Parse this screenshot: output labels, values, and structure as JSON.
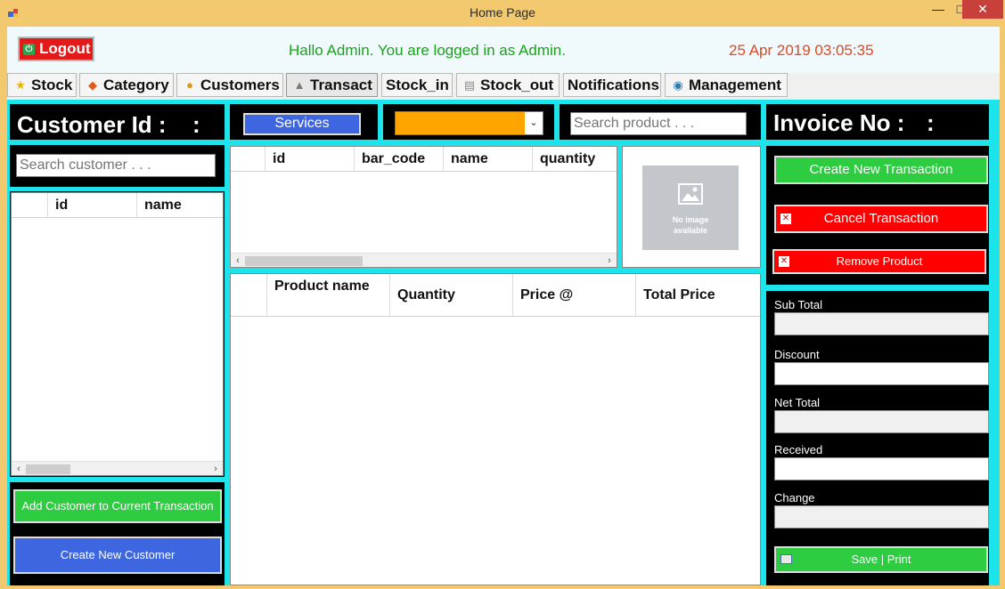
{
  "window": {
    "title": "Home Page",
    "min_glyph": "—",
    "max_glyph": "□",
    "close_glyph": "✕"
  },
  "header": {
    "logout_label": "Logout",
    "welcome": "Hallo Admin. You are logged in as Admin.",
    "datetime": "25 Apr 2019 03:05:35"
  },
  "nav": {
    "tabs": [
      {
        "label": "Stock",
        "icon": "star-icon"
      },
      {
        "label": "Category",
        "icon": "category-icon"
      },
      {
        "label": "Customers",
        "icon": "customers-icon"
      },
      {
        "label": "Transact",
        "icon": "transact-icon"
      },
      {
        "label": "Stock_in",
        "icon": ""
      },
      {
        "label": "Stock_out",
        "icon": "stock-out-icon"
      },
      {
        "label": "Notifications",
        "icon": ""
      },
      {
        "label": "Management",
        "icon": "management-icon"
      }
    ],
    "active": "Transact"
  },
  "customer_panel": {
    "title": "Customer Id :",
    "title_value": ":",
    "search_placeholder": "Search customer . . .",
    "columns": [
      "id",
      "name"
    ],
    "add_button": "Add Customer to Current Transaction",
    "create_button": "Create New Customer"
  },
  "product_panel": {
    "services_button": "Services",
    "search_placeholder": "Search product . . .",
    "product_columns": [
      "id",
      "bar_code",
      "name",
      "quantity"
    ],
    "image_text_line1": "No image",
    "image_text_line2": "available",
    "cart_columns": [
      "Product name",
      "Quantity",
      "Price @",
      "Total Price"
    ]
  },
  "invoice_panel": {
    "title": "Invoice No :",
    "title_value": ":",
    "create_button": "Create New Transaction",
    "cancel_button": "Cancel Transaction",
    "remove_button": "Remove Product",
    "fields": [
      "Sub Total",
      "Discount",
      "Net Total",
      "Received",
      "Change"
    ],
    "save_button": "Save | Print"
  },
  "colors": {
    "accent_cyan": "#1de3ea",
    "green": "#2ecc40",
    "red": "#ff0000",
    "blue": "#3e66e0",
    "orange": "#ffa500"
  }
}
